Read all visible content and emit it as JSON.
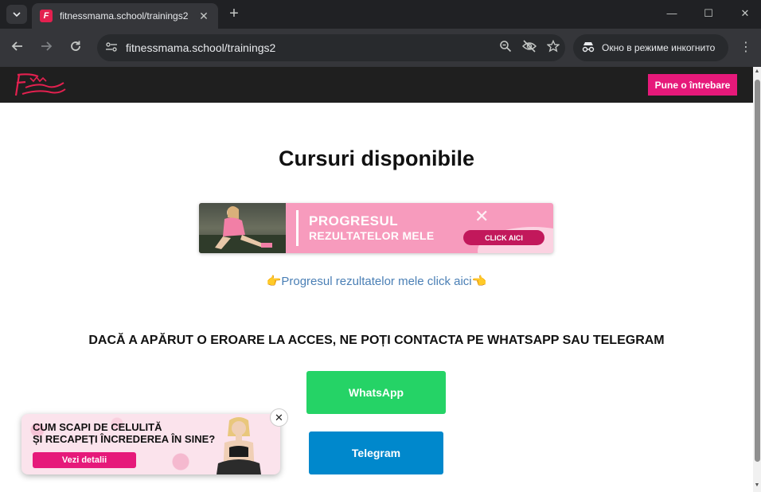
{
  "browser": {
    "tab": {
      "title": "fitnessmama.school/trainings2"
    },
    "url": "fitnessmama.school/trainings2",
    "incognito_label": "Окно в режиме инкогнито",
    "icons": {
      "tab_search": "chevron-down-icon",
      "favicon": "fitnessmama-favicon",
      "tab_close": "close-icon",
      "new_tab": "plus-icon",
      "minimize": "minimize-icon",
      "maximize": "maximize-icon",
      "close": "close-icon",
      "back": "back-arrow-icon",
      "forward": "forward-arrow-icon",
      "reload": "reload-icon",
      "site_info": "tune-icon",
      "zoom": "zoom-icon",
      "tracking": "eye-off-icon",
      "bookmark": "star-icon",
      "incognito": "incognito-icon",
      "menu": "kebab-menu-icon"
    }
  },
  "site": {
    "header": {
      "ask_button": "Pune o întrebare"
    },
    "title": "Cursuri disponibile",
    "banner": {
      "line1": "PROGRESUL",
      "line2": "REZULTATELOR MELE",
      "cta": "CLICK AICI"
    },
    "progress_link": "👉Progresul rezultatelor mele click aici👈",
    "contact_heading": "DACĂ A APĂRUT O EROARE LA ACCES, NE POȚI CONTACTA PE WHATSAPP SAU TELEGRAM",
    "whatsapp_button": "WhatsApp",
    "telegram_button": "Telegram",
    "popup": {
      "line1": "CUM SCAPI DE CELULITĂ",
      "line2": "ȘI RECAPEȚI ÎNCREDEREA ÎN SINE?",
      "cta": "Vezi detalii"
    }
  },
  "colors": {
    "accent_pink": "#e6197a",
    "whatsapp_green": "#25d366",
    "telegram_blue": "#0088cc",
    "link_blue": "#4a7fb5"
  }
}
